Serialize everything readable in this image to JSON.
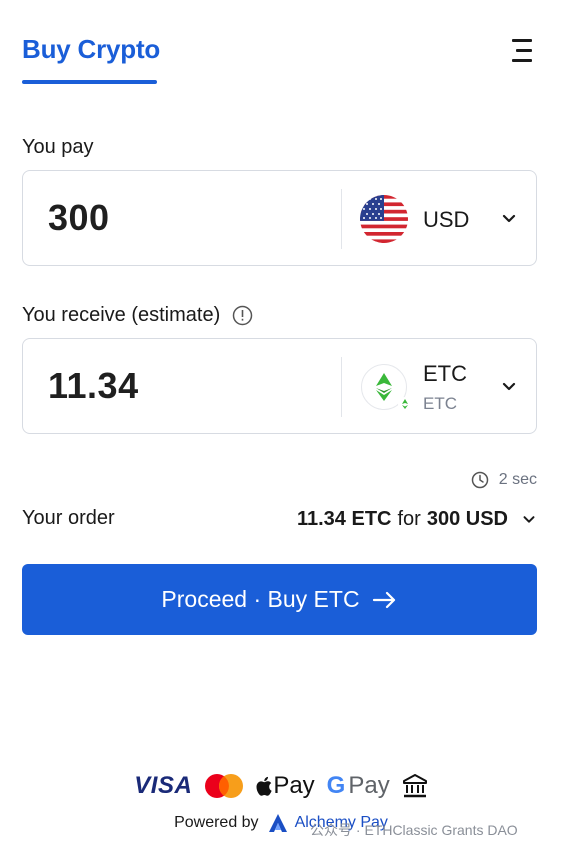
{
  "header": {
    "tab_title": "Buy Crypto"
  },
  "pay": {
    "label": "You pay",
    "amount": "300",
    "currency": "USD"
  },
  "receive": {
    "label": "You receive (estimate)",
    "amount": "11.34",
    "currency": "ETC",
    "currency_network": "ETC"
  },
  "timer": {
    "value": "2 sec"
  },
  "order": {
    "label": "Your order",
    "receive_amount": "11.34 ETC",
    "connector": "for",
    "pay_amount": "300 USD"
  },
  "proceed_button": {
    "label": "Proceed · Buy ETC"
  },
  "payments": {
    "visa": "VISA",
    "apple_pay": "Pay",
    "google_pay_g": "G",
    "google_pay": "Pay"
  },
  "footer": {
    "powered_by": "Powered by",
    "provider": "Alchemy Pay"
  },
  "watermark": "公众号 · ETHClassic Grants DAO",
  "colors": {
    "accent": "#1a5ed8",
    "etc_green": "#3ab83a",
    "text": "#1a1a1a"
  },
  "icons": [
    "hamburger-menu-icon",
    "usd-flag-icon",
    "chevron-down-icon",
    "etc-coin-icon",
    "info-icon",
    "clock-icon",
    "arrow-right-icon",
    "visa-logo",
    "mastercard-logo",
    "apple-pay-logo",
    "google-pay-logo",
    "bank-icon",
    "alchemy-pay-logo"
  ]
}
